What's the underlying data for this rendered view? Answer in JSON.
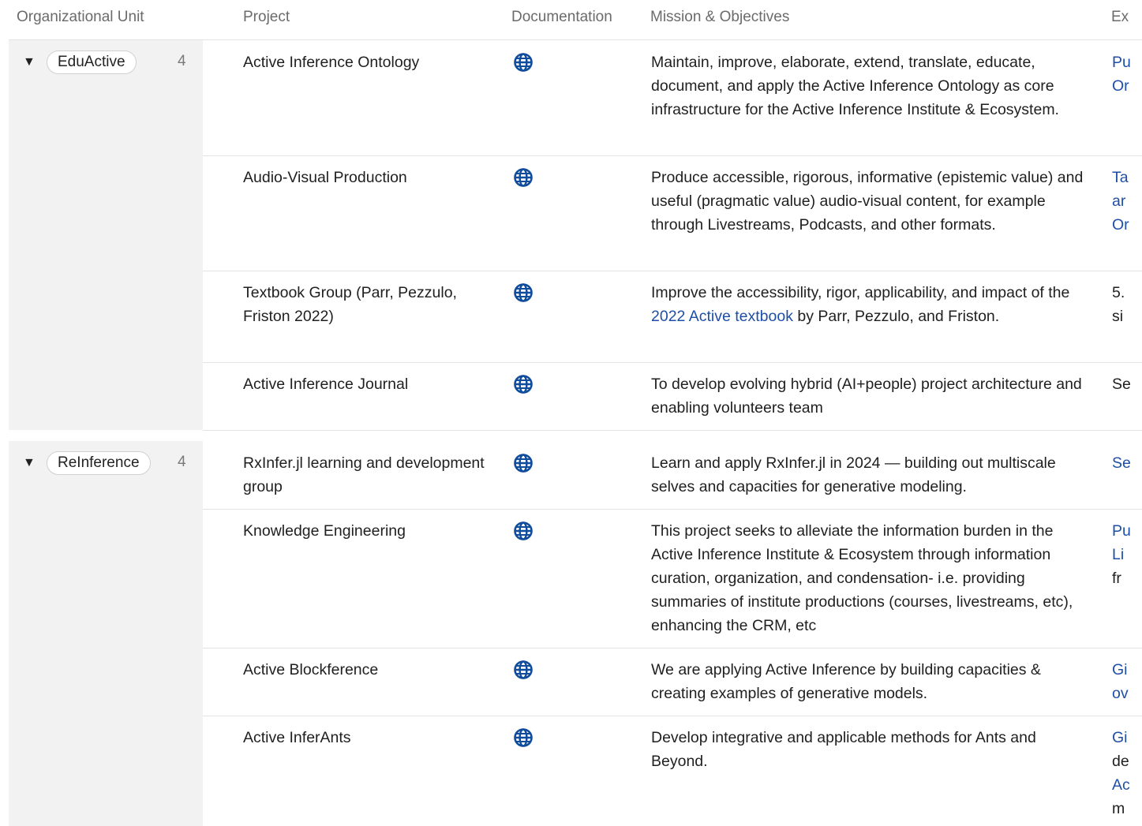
{
  "header": {
    "col_org": "Organizational Unit",
    "col_project": "Project",
    "col_doc": "Documentation",
    "col_mission": "Mission & Objectives",
    "col_extra": "Ex"
  },
  "colors": {
    "link": "#1e4fa6",
    "globe_icon": "#0f4c9c",
    "group_band": "#f2f2f2"
  },
  "groups": [
    {
      "toggle": "▼",
      "name": "EduActive",
      "count": "4",
      "rows": [
        {
          "project": "Active Inference Ontology",
          "doc_icon": "globe-icon",
          "mission": "Maintain, improve, elaborate, extend, translate, educate, document, and apply the Active Inference Ontology as core infrastructure for the Active Inference Institute & Ecosystem.",
          "extra_lines": [
            "Pu",
            "Or"
          ],
          "extra_is_link": true
        },
        {
          "project": "Audio-Visual Production",
          "doc_icon": "globe-icon",
          "mission": "Produce accessible, rigorous, informative (epistemic value) and useful (pragmatic value) audio-visual content, for example through Livestreams, Podcasts, and other formats.",
          "extra_lines": [
            "Ta",
            "ar",
            "Or"
          ],
          "extra_is_link": true
        },
        {
          "project": "Textbook Group (Parr, Pezzulo, Friston 2022)",
          "doc_icon": "globe-icon",
          "mission_before": "Improve the accessibility, rigor, applicability, and impact of the ",
          "mission_link": "2022 Active textbook",
          "mission_after": " by Parr, Pezzulo, and Friston.",
          "extra_lines": [
            "5.",
            "si"
          ],
          "extra_is_link": false
        },
        {
          "project": "Active Inference Journal",
          "doc_icon": "globe-icon",
          "mission": "To develop evolving hybrid (AI+people) project architecture and enabling volunteers team",
          "extra_lines": [
            "Se"
          ],
          "extra_is_link": false
        }
      ]
    },
    {
      "toggle": "▼",
      "name": "ReInference",
      "count": "4",
      "rows": [
        {
          "project": "RxInfer.jl learning and development group",
          "doc_icon": "globe-icon",
          "mission": "Learn and apply RxInfer.jl in 2024 — building out multiscale selves and capacities for generative modeling.",
          "extra_lines": [
            "Se"
          ],
          "extra_is_link": true
        },
        {
          "project": "Knowledge Engineering",
          "doc_icon": "globe-icon",
          "mission": "This project seeks to alleviate the information burden in the Active Inference Institute & Ecosystem through information curation, organization, and condensation- i.e. providing summaries of institute productions (courses, livestreams, etc), enhancing the CRM, etc",
          "extra_lines": [
            "Pu",
            "Li",
            "fr"
          ],
          "extra_link_lines": 2
        },
        {
          "project": "Active Blockference",
          "doc_icon": "globe-icon",
          "mission": "We are applying Active Inference by building capacities & creating examples of generative models.",
          "extra_lines": [
            "Gi",
            "ov"
          ],
          "extra_is_link": true
        },
        {
          "project": "Active InferAnts",
          "doc_icon": "globe-icon",
          "mission": "Develop integrative and applicable methods for Ants and Beyond.",
          "extra_lines": [
            "Gi",
            "de",
            "Ac",
            "m"
          ],
          "extra_link_pattern": [
            true,
            false,
            true,
            false
          ]
        }
      ]
    }
  ]
}
